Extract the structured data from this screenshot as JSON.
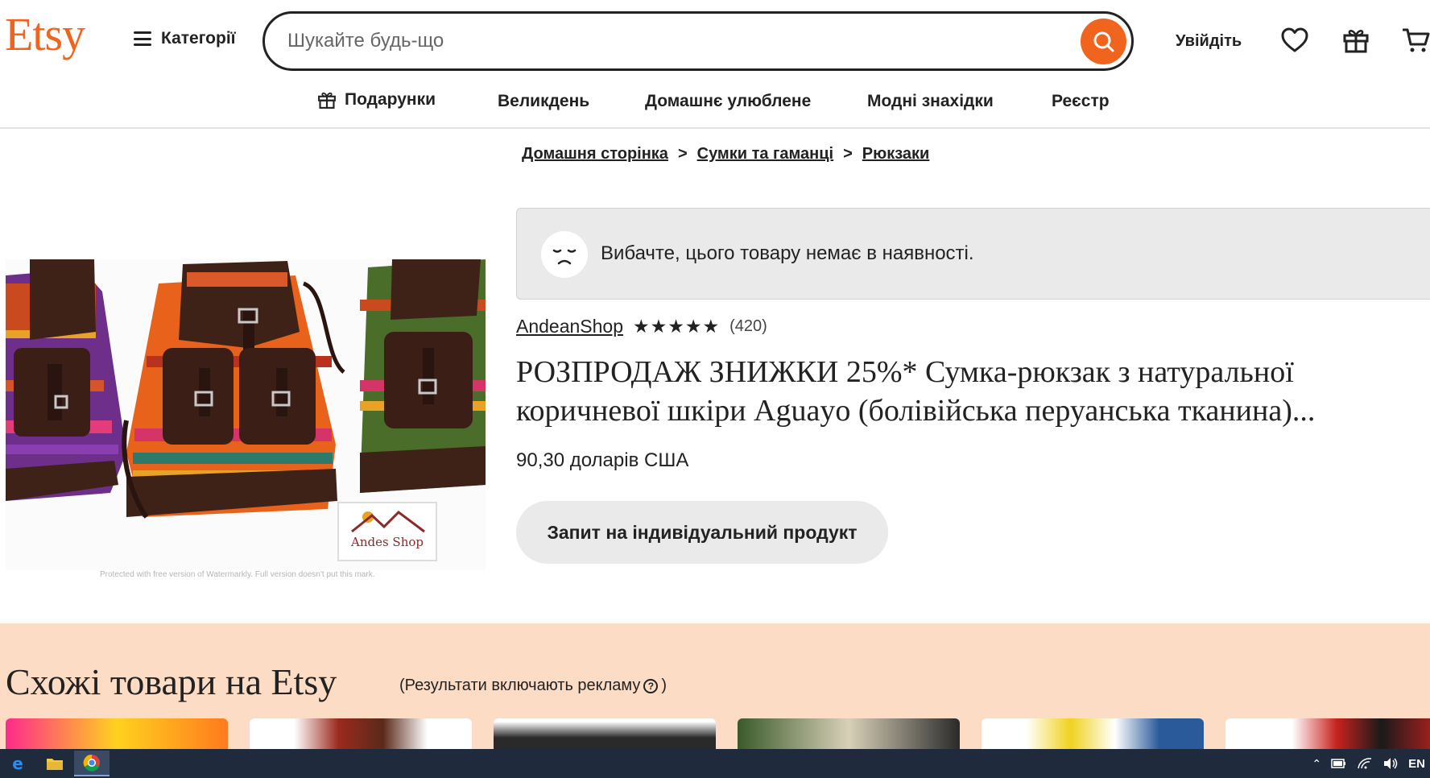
{
  "header": {
    "logo": "Etsy",
    "categories_label": "Категорії",
    "search_placeholder": "Шукайте будь-що",
    "signin_label": "Увійдіть"
  },
  "nav": {
    "items": [
      {
        "label": "Подарунки"
      },
      {
        "label": "Великдень"
      },
      {
        "label": "Домашнє улюблене"
      },
      {
        "label": "Модні знахідки"
      },
      {
        "label": "Реєстр"
      }
    ]
  },
  "breadcrumb": {
    "items": [
      "Домашня сторінка",
      "Сумки та гаманці",
      "Рюкзаки"
    ],
    "separator": ">"
  },
  "product": {
    "image_watermark_text": "Protected with free version of Watermarkly. Full version doesn't put this mark.",
    "image_logo_text": "Andes Shop",
    "out_of_stock": "Вибачте, цього товару немає в наявності.",
    "shop_name": "AndeanShop",
    "rating": 5,
    "stars": "★★★★★",
    "reviews": "(420)",
    "title_line1": "РОЗПРОДАЖ ЗНИЖКИ 25%* Сумка-рюкзак з натуральної",
    "title_line2": "коричневої шкіри Aguayo (болівійська перуанська тканина)...",
    "price": "90,30 доларів США",
    "request_button": "Запит на індивідуальний продукт"
  },
  "similar": {
    "title": "Схожі товари на Etsy",
    "note": "(Результати включають рекламу",
    "note_close": ")"
  },
  "taskbar": {
    "lang": "EN"
  },
  "colors": {
    "brand": "#f1641e",
    "similar_bg": "#fddcc5",
    "notice_bg": "#eaeaea",
    "taskbar_bg": "#1f2a3c"
  }
}
